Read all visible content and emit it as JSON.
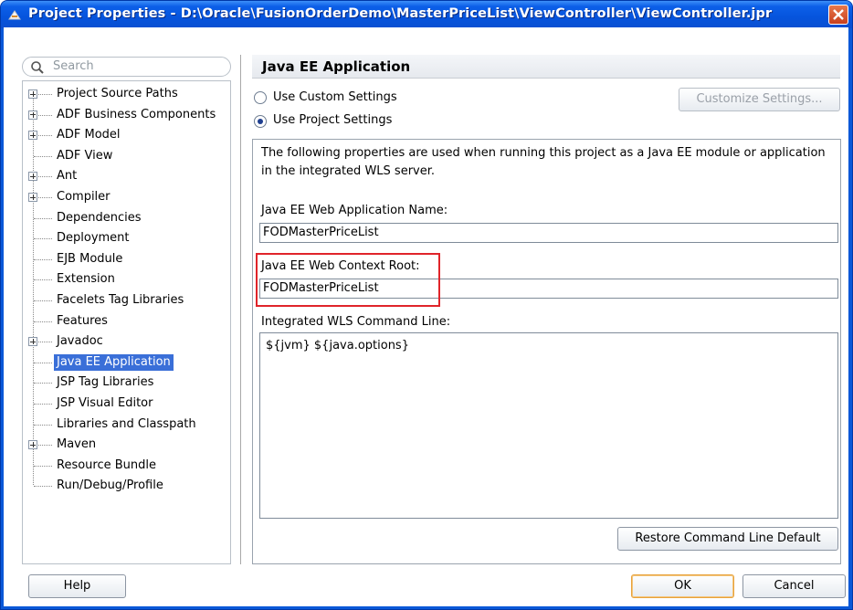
{
  "window": {
    "title": "Project Properties - D:\\Oracle\\FusionOrderDemo\\MasterPriceList\\ViewController\\ViewController.jpr"
  },
  "search": {
    "placeholder": "Search"
  },
  "tree": {
    "items": [
      {
        "label": "Project Source Paths",
        "expandable": true
      },
      {
        "label": "ADF Business Components",
        "expandable": true
      },
      {
        "label": "ADF Model",
        "expandable": true
      },
      {
        "label": "ADF View",
        "expandable": false
      },
      {
        "label": "Ant",
        "expandable": true
      },
      {
        "label": "Compiler",
        "expandable": true
      },
      {
        "label": "Dependencies",
        "expandable": false
      },
      {
        "label": "Deployment",
        "expandable": false
      },
      {
        "label": "EJB Module",
        "expandable": false
      },
      {
        "label": "Extension",
        "expandable": false
      },
      {
        "label": "Facelets Tag Libraries",
        "expandable": false
      },
      {
        "label": "Features",
        "expandable": false
      },
      {
        "label": "Javadoc",
        "expandable": true
      },
      {
        "label": "Java EE Application",
        "expandable": false,
        "selected": true
      },
      {
        "label": "JSP Tag Libraries",
        "expandable": false
      },
      {
        "label": "JSP Visual Editor",
        "expandable": false
      },
      {
        "label": "Libraries and Classpath",
        "expandable": false
      },
      {
        "label": "Maven",
        "expandable": true
      },
      {
        "label": "Resource Bundle",
        "expandable": false
      },
      {
        "label": "Run/Debug/Profile",
        "expandable": false
      }
    ]
  },
  "panel": {
    "title": "Java EE Application",
    "radio_custom": "Use Custom Settings",
    "radio_project": "Use Project Settings",
    "customize_button": "Customize Settings...",
    "description": "The following properties are used when running this project as a Java EE module or application in the integrated WLS server.",
    "app_name_label": "Java EE Web Application Name:",
    "app_name_value": "FODMasterPriceList",
    "context_root_label": "Java EE Web Context Root:",
    "context_root_value": "FODMasterPriceList",
    "command_line_label": "Integrated WLS Command Line:",
    "command_line_value": "${jvm} ${java.options}",
    "restore_button": "Restore Command Line Default"
  },
  "footer": {
    "help_button": "Help",
    "ok_button": "OK",
    "cancel_button": "Cancel"
  },
  "colors": {
    "titlebar": "#0654dd",
    "selection": "#3a6fd8",
    "highlight_box": "#e0242a"
  }
}
